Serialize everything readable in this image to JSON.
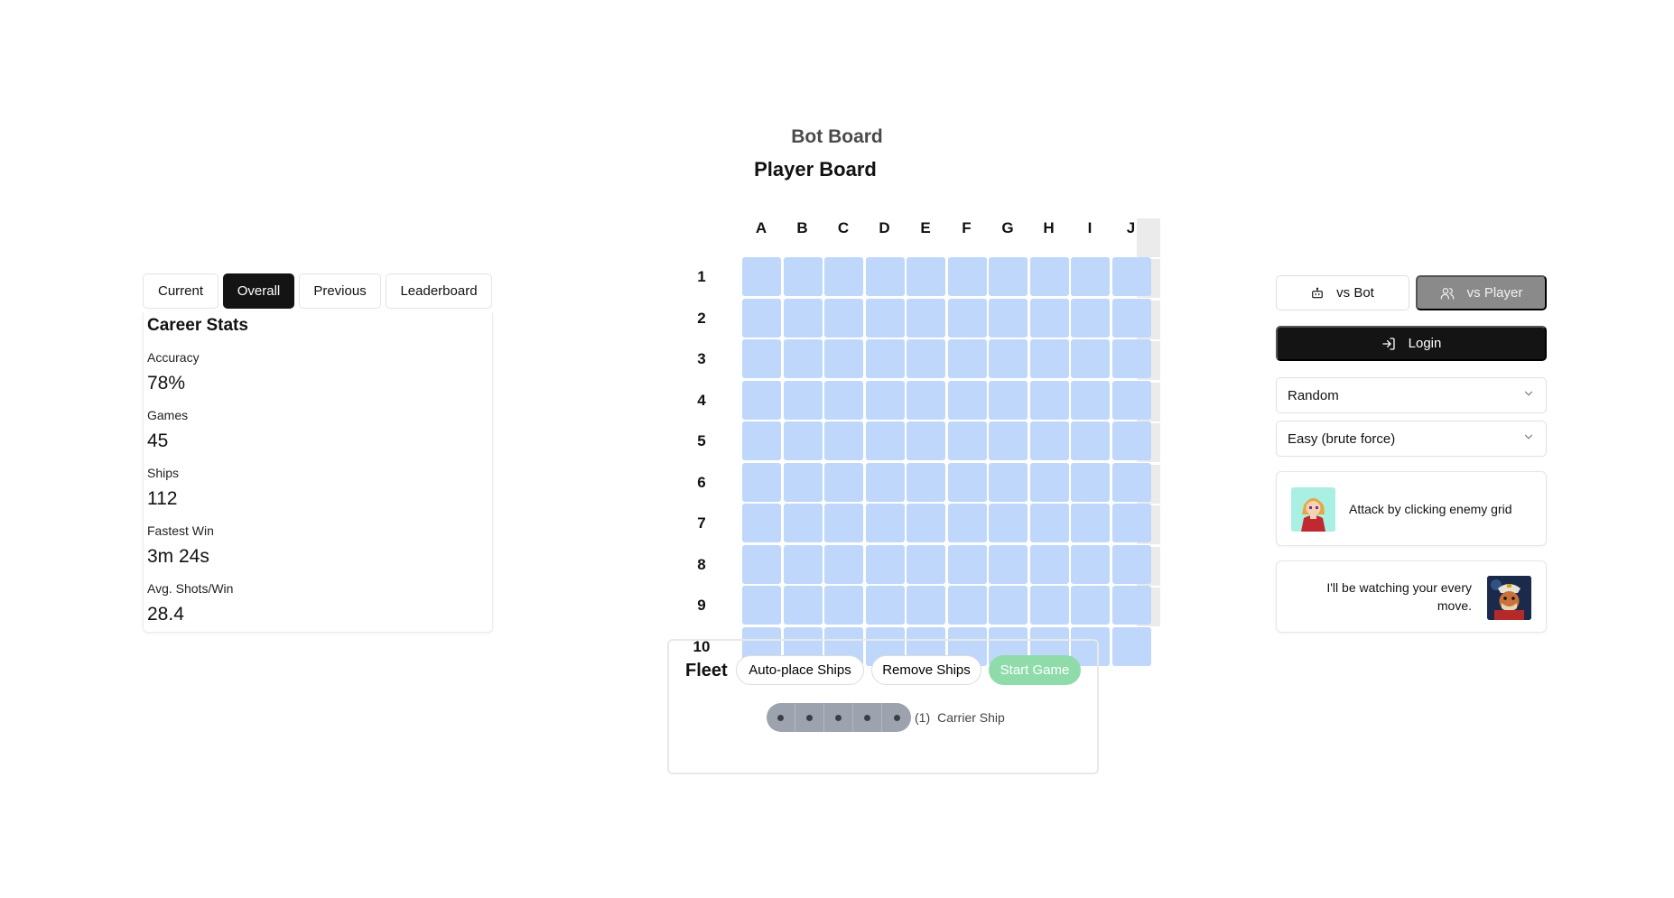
{
  "titles": {
    "bot_board": "Bot Board",
    "player_board": "Player Board"
  },
  "stats": {
    "tabs": [
      "Current",
      "Overall",
      "Previous",
      "Leaderboard"
    ],
    "active_tab": "Overall",
    "heading": "Career Stats",
    "items": [
      {
        "label": "Accuracy",
        "value": "78%"
      },
      {
        "label": "Games",
        "value": "45"
      },
      {
        "label": "Ships",
        "value": "112"
      },
      {
        "label": "Fastest Win",
        "value": "3m 24s"
      },
      {
        "label": "Avg. Shots/Win",
        "value": "28.4"
      }
    ]
  },
  "board": {
    "columns": [
      "A",
      "B",
      "C",
      "D",
      "E",
      "F",
      "G",
      "H",
      "I",
      "J"
    ],
    "rows": [
      "1",
      "2",
      "3",
      "4",
      "5",
      "6",
      "7",
      "8",
      "9",
      "10"
    ],
    "cell_color": "#bed7fb"
  },
  "fleet": {
    "title": "Fleet",
    "auto_place_label": "Auto-place Ships",
    "remove_label": "Remove Ships",
    "start_label": "Start Game",
    "ships": [
      {
        "name": "Carrier Ship",
        "count": "(1)",
        "size": 5
      }
    ]
  },
  "right_panel": {
    "vs_bot_label": "vs Bot",
    "vs_player_label": "vs Player",
    "login_label": "Login",
    "placement_select": "Random",
    "difficulty_select": "Easy (brute force)",
    "player_message": "Attack by clicking enemy grid",
    "bot_message": "I'll be watching your every move."
  },
  "colors": {
    "accent_dark": "#141414",
    "start_button": "#8fdcaa",
    "ship_segment": "#9ca3af"
  }
}
